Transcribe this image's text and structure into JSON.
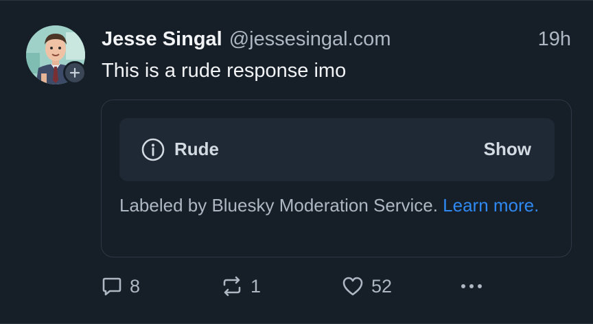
{
  "post": {
    "display_name": "Jesse Singal",
    "handle": "@jessesingal.com",
    "time": "19h",
    "text": "This is a rude response imo",
    "avatar_icon": "avatar-cartoon-man",
    "follow_icon": "plus-icon"
  },
  "moderation": {
    "label": "Rude",
    "show_label": "Show",
    "note": "Labeled by Bluesky Moderation Service.",
    "learn_more": "Learn more.",
    "link_color": "#2f89f5"
  },
  "actions": {
    "reply_count": "8",
    "repost_count": "1",
    "like_count": "52"
  },
  "colors": {
    "background": "#161e27",
    "card_row": "#1f2936",
    "text_primary": "#f1f3f5",
    "text_secondary": "#aeb8c4"
  }
}
